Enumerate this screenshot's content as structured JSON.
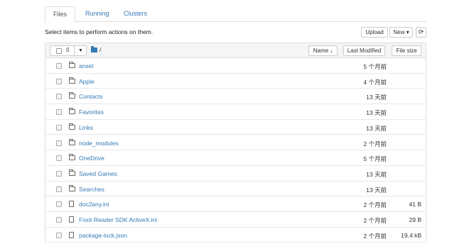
{
  "tabs": [
    {
      "label": "Files"
    },
    {
      "label": "Running"
    },
    {
      "label": "Clusters"
    }
  ],
  "instructions": "Select items to perform actions on them.",
  "toolbar": {
    "upload_label": "Upload",
    "new_label": "New ▾",
    "refresh_glyph": "⟳"
  },
  "list_header": {
    "selected_count": "0",
    "breadcrumb_sep": "/",
    "sort_name_label": "Name ↓",
    "sort_modified_label": "Last Modified",
    "sort_size_label": "File size"
  },
  "rows": [
    {
      "type": "folder",
      "name": "ansel",
      "modified": "5 个月前",
      "size": ""
    },
    {
      "type": "folder",
      "name": "Apple",
      "modified": "4 个月前",
      "size": ""
    },
    {
      "type": "folder",
      "name": "Contacts",
      "modified": "13 天前",
      "size": ""
    },
    {
      "type": "folder",
      "name": "Favorites",
      "modified": "13 天前",
      "size": ""
    },
    {
      "type": "folder",
      "name": "Links",
      "modified": "13 天前",
      "size": ""
    },
    {
      "type": "folder",
      "name": "node_modules",
      "modified": "2 个月前",
      "size": ""
    },
    {
      "type": "folder",
      "name": "OneDrive",
      "modified": "5 个月前",
      "size": ""
    },
    {
      "type": "folder",
      "name": "Saved Games",
      "modified": "13 天前",
      "size": ""
    },
    {
      "type": "folder",
      "name": "Searches",
      "modified": "13 天前",
      "size": ""
    },
    {
      "type": "file",
      "name": "doc2any.ini",
      "modified": "2 个月前",
      "size": "41 B"
    },
    {
      "type": "file",
      "name": "Foxit Reader SDK ActiveX.ini",
      "modified": "2 个月前",
      "size": "29 B"
    },
    {
      "type": "file",
      "name": "package-lock.json",
      "modified": "2 个月前",
      "size": "19.4 kB"
    }
  ]
}
